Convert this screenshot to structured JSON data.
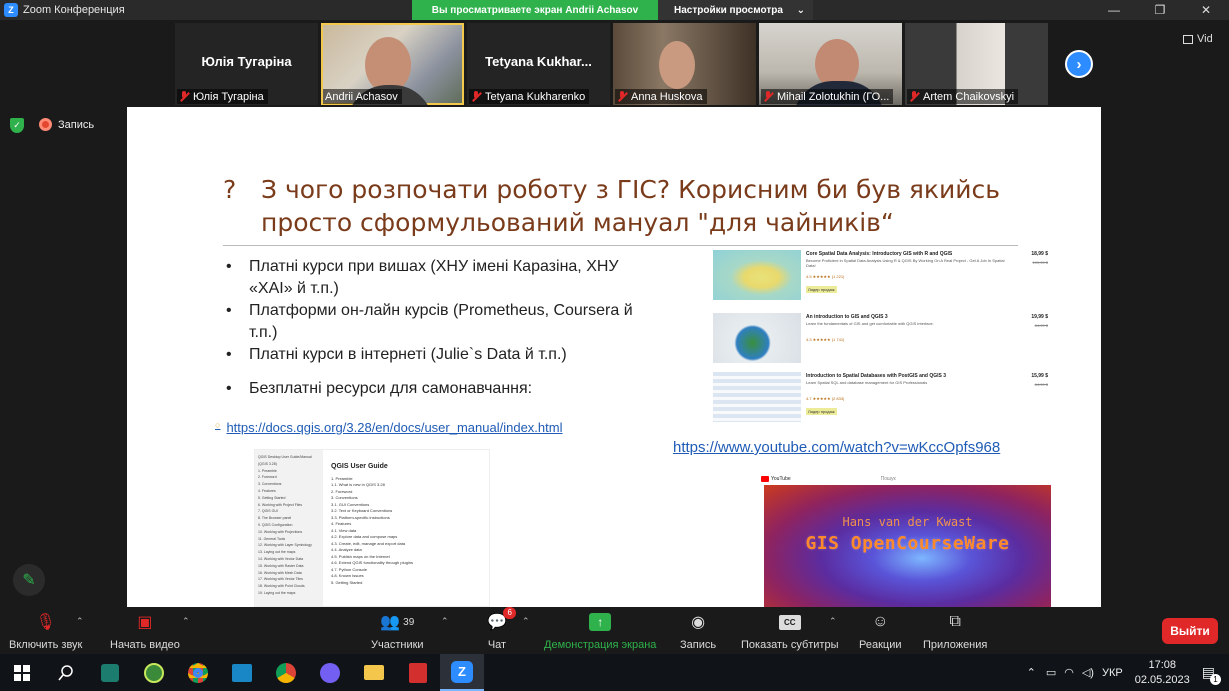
{
  "window": {
    "title": "Zoom Конференция",
    "share_banner": "Вы просматриваете экран Andrii Achasov",
    "view_options": "Настройки просмотра",
    "minimize": "—",
    "maximize": "❐",
    "close": "✕"
  },
  "gallery": {
    "participants": [
      {
        "display_name": "Юлія Тугаріна",
        "label": "Юлія Тугаріна",
        "video": false,
        "muted": true
      },
      {
        "display_name": "",
        "label": "Andrii Achasov",
        "video": true,
        "muted": false,
        "active_speaker": true
      },
      {
        "display_name": "Tetyana  Kukhar...",
        "label": "Tetyana Kukharenko",
        "video": false,
        "muted": true
      },
      {
        "display_name": "",
        "label": "Anna Huskova",
        "video": true,
        "muted": true
      },
      {
        "display_name": "",
        "label": "Mihail Zolotukhin (ГО...",
        "video": true,
        "muted": true
      },
      {
        "display_name": "",
        "label": "Artem Chaikovskyi",
        "video": true,
        "muted": true
      }
    ],
    "next_icon": "›",
    "view_label": "Vid"
  },
  "status": {
    "recording_label": "Запись"
  },
  "slide": {
    "question_mark": "?",
    "title": "З чого розпочати роботу з ГІС? Корисним би був якийсь просто сформульований мануал \"для чайників“",
    "bullets": [
      "Платні курси при вишах (ХНУ імені Каразіна, ХНУ «ХАІ» й т.п.)",
      "Платформи он-лайн курсів (Prometheus, Coursera й т.п.)",
      "Платні курси в інтернеті (Julie`s Data й т.п.)",
      "Безплатні ресурси для самонавчання:"
    ],
    "docs_link": "https://docs.qgis.org/3.28/en/docs/user_manual/index.html",
    "youtube_link": "https://www.youtube.com/watch?v=wKccOpfs968",
    "courses": [
      {
        "title": "Core Spatial Data Analysis: Introductory GIS with R and QGIS",
        "desc": "Become Proficient in Spatial Data Analysis Using R & QGIS By Working On A Real Project - Get A Job In Spatial Data!",
        "rating": "4.5 ★★★★★ (1 221)",
        "tag": "Лидер продаж",
        "price": "18,99 $",
        "old_price": "109,99 $"
      },
      {
        "title": "An introduction to GIS and QGIS 3",
        "desc": "Learn the fundamentals of GIS and get comfortable with QGIS interface.",
        "rating": "4.3 ★★★★★ (1 741)",
        "tag": "",
        "price": "19,99 $",
        "old_price": "84,99 $"
      },
      {
        "title": "Introduction to Spatial Databases with PostGIS and QGIS 3",
        "desc": "Learn Spatial SQL and database management for GIS Professionals",
        "rating": "4.7 ★★★★★ (2 833)",
        "tag": "Лидер продаж",
        "price": "15,99 $",
        "old_price": "84,99 $"
      }
    ],
    "qgis_doc": {
      "guide_title": "QGIS User Guide",
      "toc": [
        "QGIS Desktop User Guide/Manual (QGIS 3.28)",
        "1. Preamble",
        "2. Foreword",
        "3. Conventions",
        "4. Features",
        "5. Getting Started",
        "6. Working with Project Files",
        "7. QGIS GUI",
        "8. The Browser panel",
        "9. QGIS Configuration",
        "10. Working with Projections",
        "11. General Tools",
        "12. Working with Layer Symbology",
        "13. Laying out the maps",
        "14. Working with Vector Data",
        "15. Working with Raster Data",
        "16. Working with Mesh Data",
        "17. Working with Vector Tiles",
        "18. Working with Point Clouds",
        "19. Laying out the maps"
      ],
      "sections": [
        "1. Preamble",
        "1.1. What is new in QGIS 3.28",
        "2. Foreword",
        "3. Conventions",
        "3.1. GUI Conventions",
        "3.2. Text or Keyboard Conventions",
        "3.3. Platform-specific instructions",
        "4. Features",
        "4.1. View data",
        "4.2. Explore data and compose maps",
        "4.3. Create, edit, manage and export data",
        "4.4. Analyze data",
        "4.5. Publish maps on the Internet",
        "4.6. Extend QGIS functionality through plugins",
        "4.7. Python Console",
        "4.8. Known Issues",
        "5. Getting Started"
      ]
    },
    "youtube": {
      "brand": "YouTube",
      "search": "Пошук",
      "author": "Hans van der Kwast",
      "video_title": "GIS OpenCourseWare"
    }
  },
  "toolbar": {
    "mute": "Включить звук",
    "video": "Начать видео",
    "participants": "Участники",
    "participants_count": "39",
    "chat": "Чат",
    "chat_badge": "6",
    "share": "Демонстрация экрана",
    "record": "Запись",
    "captions": "Показать субтитры",
    "captions_icon": "CC",
    "reactions": "Реакции",
    "apps": "Приложения",
    "end": "Выйти"
  },
  "taskbar": {
    "lang": "УКР",
    "time": "17:08",
    "date": "02.05.2023",
    "notifications": "1"
  }
}
